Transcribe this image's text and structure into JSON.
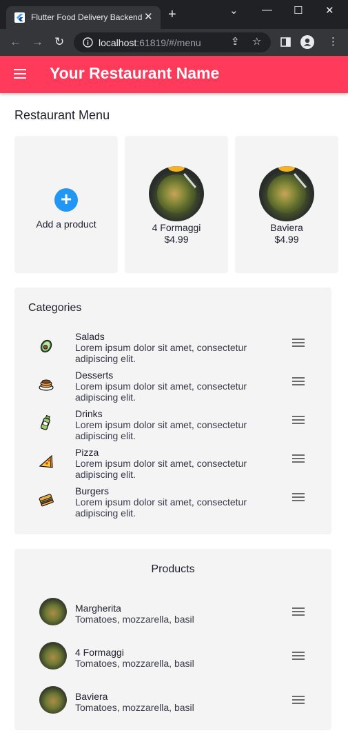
{
  "browser": {
    "tab_title": "Flutter Food Delivery Backend",
    "url_host": "localhost",
    "url_rest": ":61819/#/menu"
  },
  "app": {
    "title": "Your Restaurant Name",
    "accent": "#ff3a5b"
  },
  "menu": {
    "heading": "Restaurant Menu",
    "add_label": "Add a product",
    "cards": [
      {
        "name": "4 Formaggi",
        "price": "$4.99"
      },
      {
        "name": "Baviera",
        "price": "$4.99"
      }
    ]
  },
  "categories": {
    "heading": "Categories",
    "items": [
      {
        "title": "Salads",
        "description": "Lorem ipsum dolor sit amet, consectetur adipiscing elit.",
        "icon": "avocado-icon"
      },
      {
        "title": "Desserts",
        "description": "Lorem ipsum dolor sit amet, consectetur adipiscing elit.",
        "icon": "pancakes-icon"
      },
      {
        "title": "Drinks",
        "description": "Lorem ipsum dolor sit amet, consectetur adipiscing elit.",
        "icon": "bottle-icon"
      },
      {
        "title": "Pizza",
        "description": "Lorem ipsum dolor sit amet, consectetur adipiscing elit.",
        "icon": "pizza-icon"
      },
      {
        "title": "Burgers",
        "description": "Lorem ipsum dolor sit amet, consectetur adipiscing elit.",
        "icon": "burger-icon"
      }
    ]
  },
  "products": {
    "heading": "Products",
    "items": [
      {
        "title": "Margherita",
        "description": "Tomatoes, mozzarella, basil"
      },
      {
        "title": "4 Formaggi",
        "description": "Tomatoes, mozzarella, basil"
      },
      {
        "title": "Baviera",
        "description": "Tomatoes, mozzarella, basil"
      }
    ]
  }
}
